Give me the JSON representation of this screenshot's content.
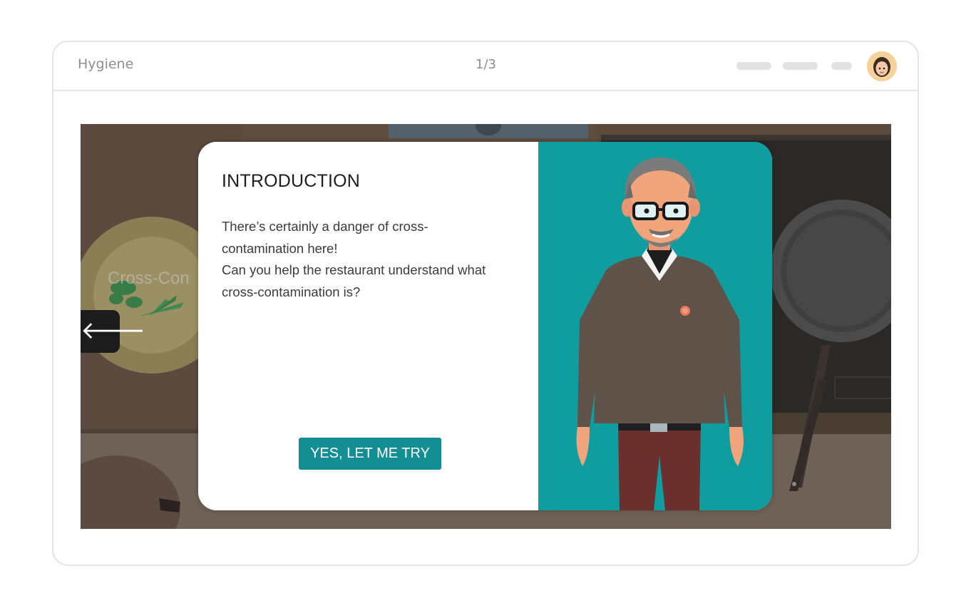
{
  "header": {
    "course_title": "Hygiene",
    "progress": "1/3"
  },
  "scene": {
    "background_label": "Cross-Con"
  },
  "modal": {
    "title": "INTRODUCTION",
    "body_lines": [
      "There’s certainly a danger of cross-contamination here!",
      "Can you help the restaurant understand what cross-contamination is?"
    ],
    "cta_label": "YES, LET ME TRY"
  },
  "icons": {
    "back": "arrow-left-icon",
    "avatar": "user-avatar"
  },
  "colors": {
    "accent": "#138f94",
    "character_panel": "#0f9da0",
    "scene_bg": "#5b4a3d"
  }
}
